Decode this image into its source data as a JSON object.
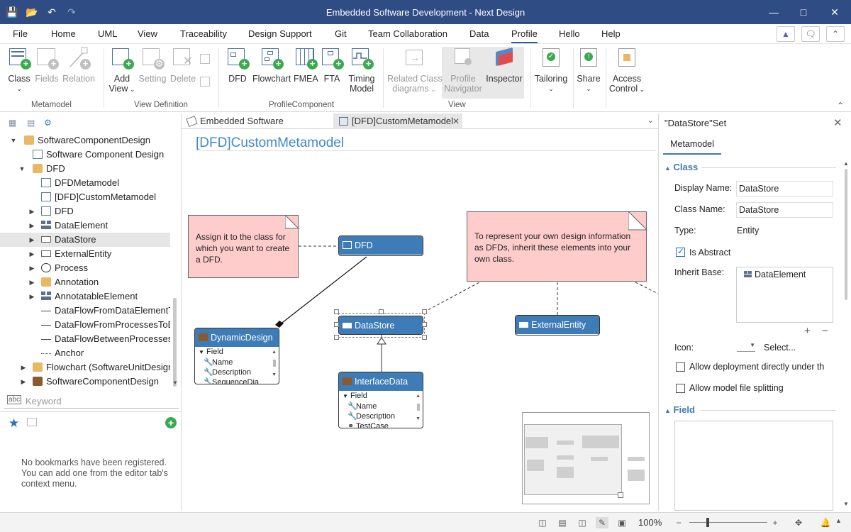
{
  "window": {
    "title": "Embedded Software Development - Next Design"
  },
  "menu": {
    "items": [
      "File",
      "Home",
      "UML",
      "View",
      "Traceability",
      "Design Support",
      "Git",
      "Team Collaboration",
      "Data",
      "Profile",
      "Hello",
      "Help"
    ],
    "active": "Profile"
  },
  "ribbon": {
    "metamodel": {
      "group": "Metamodel",
      "class": "Class",
      "fields": "Fields",
      "relation": "Relation"
    },
    "view_definition": {
      "group": "View Definition",
      "add_view_1": "Add",
      "add_view_2": "View",
      "setting": "Setting",
      "delete": "Delete"
    },
    "profile_component": {
      "group": "ProfileComponent",
      "dfd": "DFD",
      "flowchart": "Flowchart",
      "fmea": "FMEA",
      "fta": "FTA",
      "timing_1": "Timing",
      "timing_2": "Model"
    },
    "view": {
      "group": "View",
      "related_1": "Related Class",
      "related_2": "diagrams",
      "profile_nav_1": "Profile",
      "profile_nav_2": "Navigator",
      "inspector": "Inspector"
    },
    "tailoring": "Tailoring",
    "share": "Share",
    "access_1": "Access",
    "access_2": "Control"
  },
  "tree": {
    "items": [
      {
        "label": "SoftwareComponentDesign"
      },
      {
        "label": "Software Component Design"
      },
      {
        "label": "DFD"
      },
      {
        "label": "DFDMetamodel"
      },
      {
        "label": "[DFD]CustomMetamodel"
      },
      {
        "label": "DFD"
      },
      {
        "label": "DataElement"
      },
      {
        "label": "DataStore"
      },
      {
        "label": "ExternalEntity"
      },
      {
        "label": "Process"
      },
      {
        "label": "Annotation"
      },
      {
        "label": "AnnotatableElement"
      },
      {
        "label": "DataFlowFromDataElementTo"
      },
      {
        "label": "DataFlowFromProcessesToDataE"
      },
      {
        "label": "DataFlowBetweenProcesses"
      },
      {
        "label": "Anchor"
      },
      {
        "label": "Flowchart (SoftwareUnitDesign)"
      },
      {
        "label": "SoftwareComponentDesign"
      }
    ],
    "search_placeholder": "Keyword"
  },
  "bookmarks": {
    "empty_message": "No bookmarks have been registered. You can add one from the editor tab's context menu."
  },
  "tabs": [
    {
      "label": "Embedded Software Development"
    },
    {
      "label": "[DFD]CustomMetamodel"
    }
  ],
  "canvas": {
    "title": "[DFD]CustomMetamodel",
    "note_left": "Assign it to the class for which you want to create a DFD.",
    "note_right": "To represent your own design information as DFDs, inherit these elements into your own class.",
    "nodes": {
      "dfd": "DFD",
      "datastore": "DataStore",
      "external_entity": "ExternalEntity",
      "dynamic_design": "DynamicDesign",
      "interface_data": "InterfaceData"
    },
    "dynamic_design_fields": {
      "section": "Field",
      "items": [
        "Name",
        "Description",
        "SequenceDia"
      ]
    },
    "interface_data_fields": {
      "section": "Field",
      "items": [
        "Name",
        "Description",
        "TestCase"
      ]
    }
  },
  "inspector": {
    "title": "\"DataStore\"Set",
    "tab": "Metamodel",
    "section_class": "Class",
    "display_name_label": "Display Name:",
    "display_name_value": "DataStore",
    "class_name_label": "Class Name:",
    "class_name_value": "DataStore",
    "type_label": "Type:",
    "type_value": "Entity",
    "is_abstract_label": "Is Abstract",
    "is_abstract_checked": true,
    "inherit_base_label": "Inherit Base:",
    "inherit_base_items": [
      "DataElement"
    ],
    "icon_label": "Icon:",
    "icon_select": "Select...",
    "allow_deployment": "Allow deployment directly under th",
    "allow_splitting": "Allow model file splitting",
    "section_field": "Field"
  },
  "statusbar": {
    "zoom": "100%"
  }
}
